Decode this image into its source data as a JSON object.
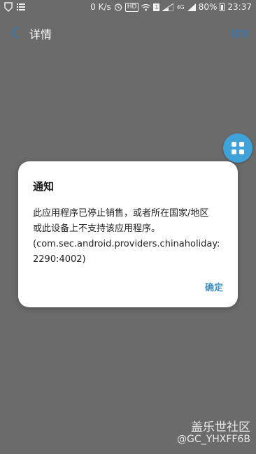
{
  "status_bar": {
    "network_speed": "0 K/s",
    "hd_badge": "HD",
    "sim_badge": "1",
    "network_type": "4G",
    "battery_percent": "80%",
    "time": "23:37"
  },
  "header": {
    "title": "详情",
    "search_label": "搜索"
  },
  "dialog": {
    "title": "通知",
    "message_lines": [
      "此应用程序已停止销售，或者所在国家/地区",
      "或此设备上不支持该应用程序。",
      "(com.sec.android.providers.chinaholiday:",
      "2290:4002)"
    ],
    "ok_label": "确定"
  },
  "watermark": {
    "site": "盖乐世社区",
    "user": "@GC_YHXFF6B"
  },
  "colors": {
    "overlay_background": "#6b6b6b",
    "accent_blue": "#3d8fc0",
    "fab_blue": "#3fa2d8",
    "dialog_background": "#ffffff"
  },
  "icons": {
    "back": "chevron-left-icon",
    "fab": "grid-icon"
  }
}
